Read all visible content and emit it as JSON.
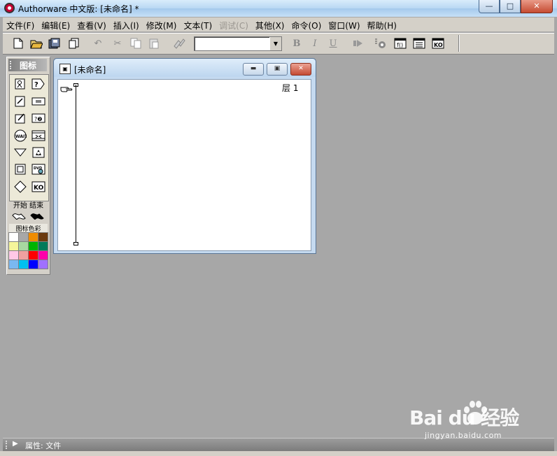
{
  "window": {
    "title": "Authorware 中文版: [未命名] *",
    "controls": {
      "minimize": "—",
      "maximize": "□",
      "close": "✕"
    }
  },
  "menubar": {
    "items": [
      {
        "label": "文件(F)"
      },
      {
        "label": "编辑(E)"
      },
      {
        "label": "查看(V)"
      },
      {
        "label": "插入(I)"
      },
      {
        "label": "修改(M)"
      },
      {
        "label": "文本(T)"
      },
      {
        "label": "调试(C)",
        "disabled": true
      },
      {
        "label": "其他(X)"
      },
      {
        "label": "命令(O)"
      },
      {
        "label": "窗口(W)"
      },
      {
        "label": "帮助(H)"
      }
    ]
  },
  "toolbar": {
    "font_select_value": "",
    "bold": "B",
    "italic": "I",
    "underline": "U"
  },
  "palette": {
    "title": "图标",
    "start_end_label": "开始 结束",
    "color_label": "图标色彩",
    "icons": [
      "display-icon",
      "motion-icon",
      "erase-icon",
      "wait-icon",
      "navigate-icon",
      "framework-icon",
      "decision-icon",
      "interaction-icon",
      "calculation-icon",
      "map-icon",
      "digital-movie-icon",
      "sound-icon",
      "video-icon",
      "knowledge-object-icon"
    ],
    "colors": [
      "#ffffff",
      "#a8a8a8",
      "#f08c00",
      "#6b3a0f",
      "#f5f59a",
      "#a8d8a0",
      "#00b400",
      "#007a5a",
      "#ffc8e6",
      "#f0a0a0",
      "#ff0000",
      "#ff00aa",
      "#7ab8f0",
      "#00c0f0",
      "#0000ff",
      "#a070ff"
    ]
  },
  "document": {
    "title": "[未命名]",
    "layer_label": "层 1"
  },
  "properties_bar": {
    "label": "属性: 文件"
  },
  "watermark": {
    "brand": "Bai  du 经验",
    "url": "jingyan.baidu.com"
  }
}
